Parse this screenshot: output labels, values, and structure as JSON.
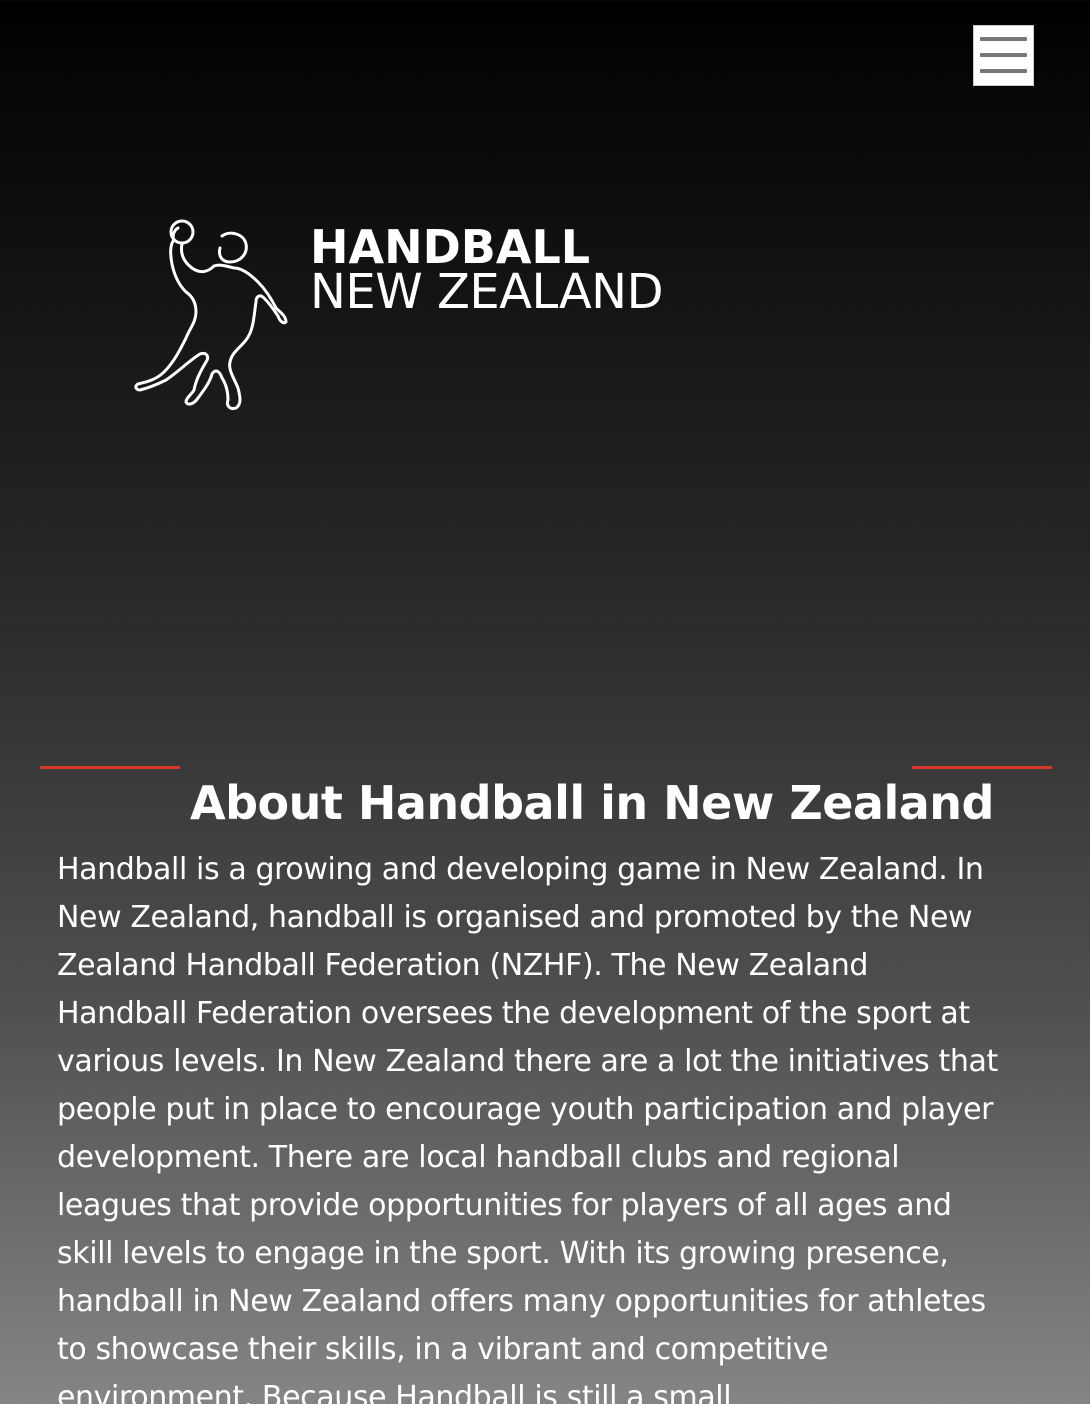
{
  "header": {
    "menu_icon": "hamburger-menu-icon"
  },
  "logo": {
    "figure_icon": "handball-player-outline-icon",
    "line1": "HANDBALL",
    "line2": "NEW ZEALAND"
  },
  "about": {
    "title": "About Handball in New Zealand",
    "accent_color": "#d7372b",
    "body": "Handball is a growing and developing game in New Zealand. In New Zealand, handball is organised and promoted by the New Zealand Handball Federation (NZHF). The New Zealand Handball Federation oversees the development of the sport at various levels. In New Zealand there are a lot the initiatives that people put in place to encourage youth participation and player development. There are local handball clubs and regional leagues that provide opportunities for players of all ages and skill levels to engage in the sport. With its growing presence, handball in New Zealand offers many opportunities for athletes to showcase their skills, in a vibrant and competitive environment. Because Handball is still a small"
  }
}
